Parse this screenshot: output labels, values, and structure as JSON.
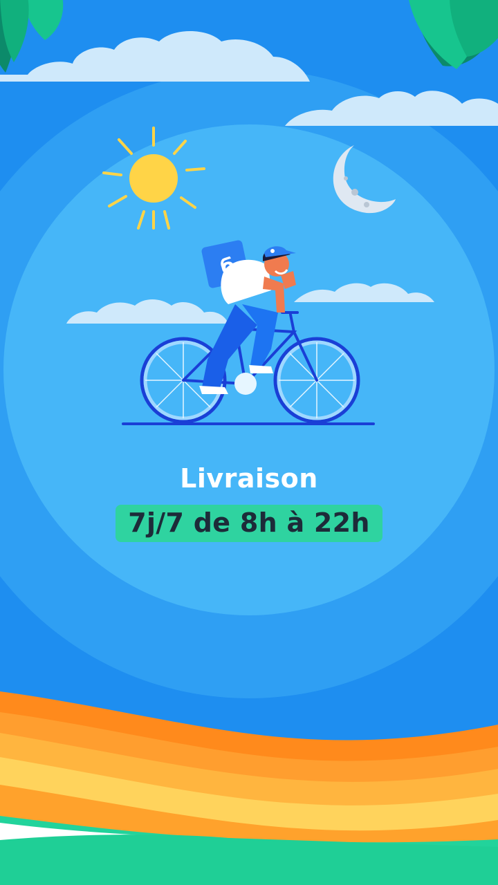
{
  "screen": {
    "heading": "Livraison",
    "schedule_badge": "7j/7 de 8h à 22h"
  },
  "illustration": {
    "subject": "delivery-cyclist",
    "icons": [
      "sun-icon",
      "moon-icon",
      "cloud-icon",
      "palm-leaf-icon",
      "bicycle-icon",
      "delivery-bag-icon"
    ]
  },
  "colors": {
    "sky_outer": "#1e8ef0",
    "sky_circle": "#3aa9f5",
    "sky_inner": "#47b7f9",
    "cloud": "#d7eefc",
    "badge_bg": "#2fd3a0",
    "stripe_orange": "#ff8a1c",
    "stripe_yellow": "#ffd35c",
    "ground_green": "#22d39b"
  }
}
